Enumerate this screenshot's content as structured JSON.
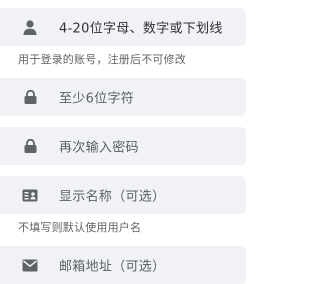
{
  "form": {
    "username": {
      "placeholder": "4-20位字母、数字或下划线",
      "hint": "用于登录的账号，注册后不可修改",
      "icon": "user-icon"
    },
    "password": {
      "placeholder": "至少6位字符",
      "icon": "lock-icon"
    },
    "confirm_password": {
      "placeholder": "再次输入密码",
      "icon": "lock-icon"
    },
    "display_name": {
      "placeholder": "显示名称（可选）",
      "hint": "不填写则默认使用用户名",
      "icon": "id-card-icon"
    },
    "email": {
      "placeholder": "邮箱地址（可选）",
      "icon": "envelope-icon"
    }
  },
  "colors": {
    "field_bg": "#f0f2f5",
    "icon": "#606266",
    "hint_text": "#606266"
  }
}
